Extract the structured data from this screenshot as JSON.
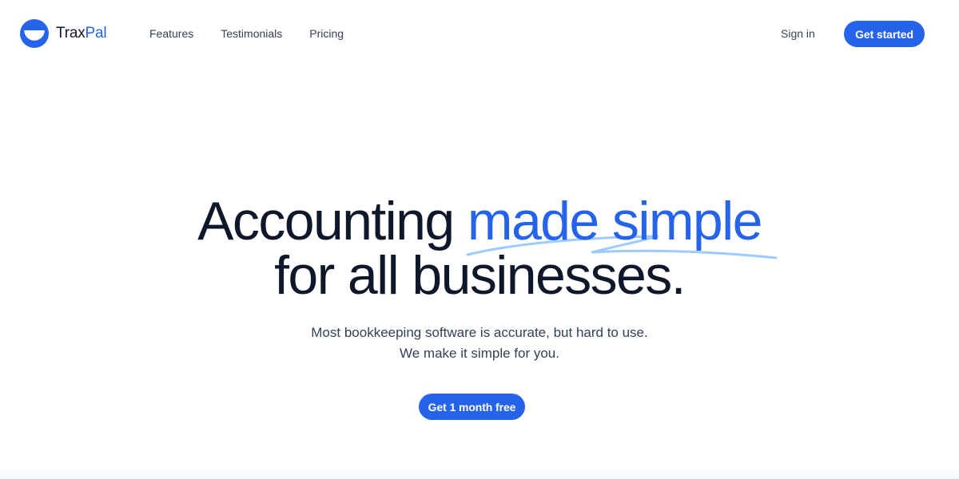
{
  "brand": {
    "name_part1": "Trax",
    "name_part2": "Pal",
    "logo_icon": "half-circle-smile-logo",
    "accent_color": "#2563eb",
    "text_color": "#0f172a"
  },
  "nav": {
    "items": [
      {
        "label": "Features"
      },
      {
        "label": "Testimonials"
      },
      {
        "label": "Pricing"
      }
    ],
    "sign_in_label": "Sign in",
    "get_started_label": "Get started"
  },
  "hero": {
    "title_line1_plain": "Accounting ",
    "title_line1_accent": "made simple",
    "title_line2": "for all businesses.",
    "subtitle_line1": "Most bookkeeping software is accurate, but hard to use.",
    "subtitle_line2": "We make it simple for you.",
    "cta_label": "Get 1 month free",
    "underline_icon": "scribble-underline-icon"
  }
}
